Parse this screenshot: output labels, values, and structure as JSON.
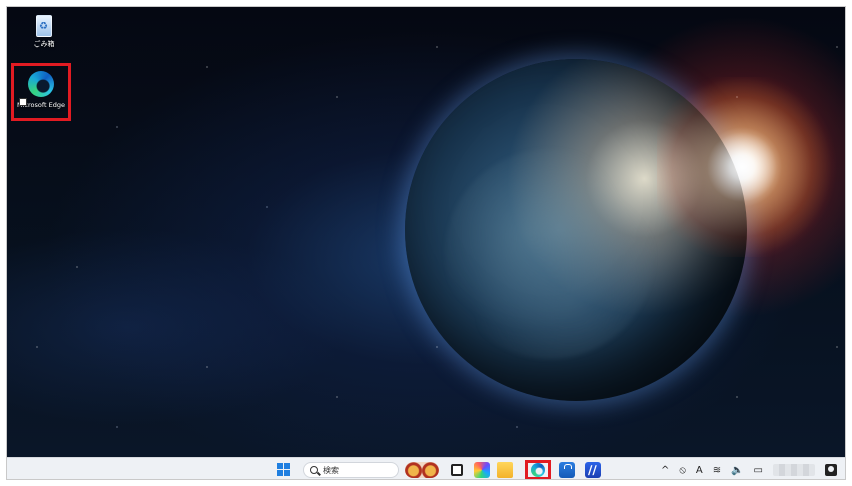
{
  "desktop": {
    "icons": {
      "recycle_bin": {
        "label": "ごみ箱"
      },
      "edge": {
        "label": "Microsoft Edge"
      }
    }
  },
  "taskbar": {
    "search": {
      "label": "検索"
    },
    "tray": {
      "ime_label": "A",
      "chevron": "^"
    }
  },
  "colors": {
    "highlight": "#e11b22",
    "taskbar_bg": "#eef1f5"
  }
}
